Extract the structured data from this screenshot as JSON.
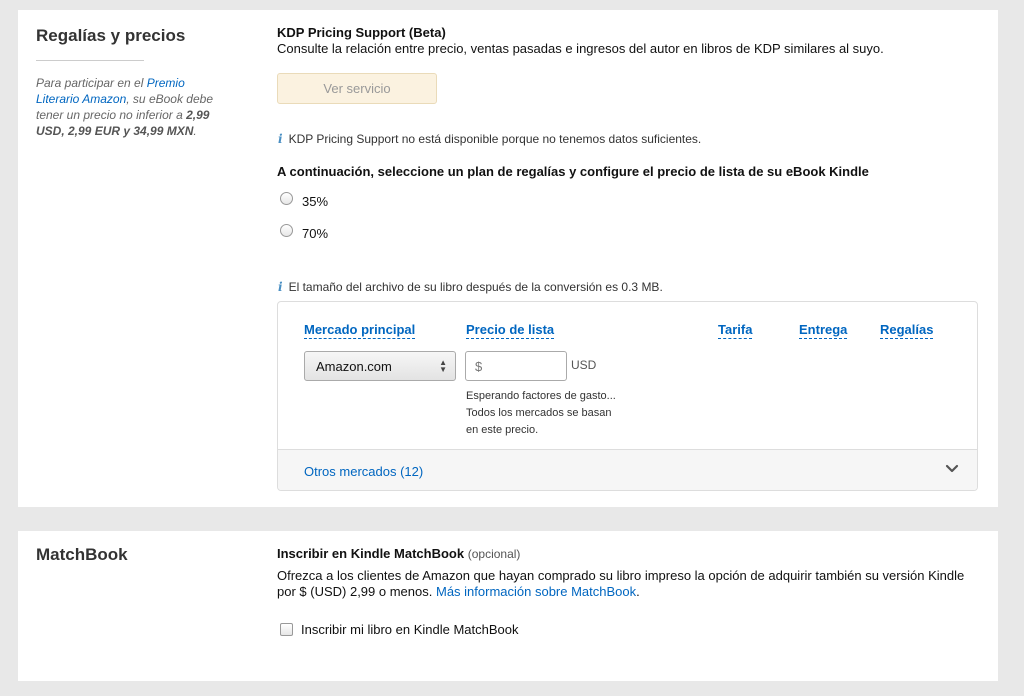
{
  "royalties": {
    "title": "Regalías y precios",
    "side_note": {
      "prefix": "Para participar en el ",
      "link": "Premio Literario Amazon",
      "middle": ", su eBook debe tener un precio no inferior a ",
      "prices": "2,99 USD, 2,99 EUR y 34,99 MXN",
      "suffix": "."
    },
    "pricing_support": {
      "title": "KDP Pricing Support (Beta)",
      "description": "Consulte la relación entre precio, ventas pasadas e ingresos del autor en libros de KDP similares al suyo.",
      "button": "Ver servicio",
      "info": "KDP Pricing Support no está disponible porque no tenemos datos suficientes."
    },
    "plan_heading": "A continuación, seleccione un plan de regalías y configure el precio de lista de su eBook Kindle",
    "plans": [
      "35%",
      "70%"
    ],
    "file_info": "El tamaño del archivo de su libro después de la conversión es 0.3 MB.",
    "table": {
      "headers": {
        "market": "Mercado principal",
        "list_price": "Precio de lista",
        "rate": "Tarifa",
        "delivery": "Entrega",
        "royalties": "Regalías"
      },
      "market_value": "Amazon.com",
      "price_placeholder": "$",
      "currency": "USD",
      "note_lines": [
        "Esperando factores de gasto...",
        "Todos los mercados se basan",
        "en este precio."
      ],
      "other_markets": "Otros mercados (12)"
    }
  },
  "matchbook": {
    "title": "MatchBook",
    "enroll_title": "Inscribir en Kindle MatchBook",
    "optional": "(opcional)",
    "description": "Ofrezca a los clientes de Amazon que hayan comprado su libro impreso la opción de adquirir también su versión Kindle por $ (USD) 2,99 o menos.",
    "more_info": "Más información sobre MatchBook",
    "period": ".",
    "checkbox_label": "Inscribir mi libro en Kindle MatchBook"
  },
  "icons": {
    "info": "info-icon",
    "chevron": "chevron-down-icon",
    "select_arrows": "select-arrows-icon"
  },
  "colors": {
    "link": "#0066c0",
    "disabled_button": "#fbf2e0"
  }
}
